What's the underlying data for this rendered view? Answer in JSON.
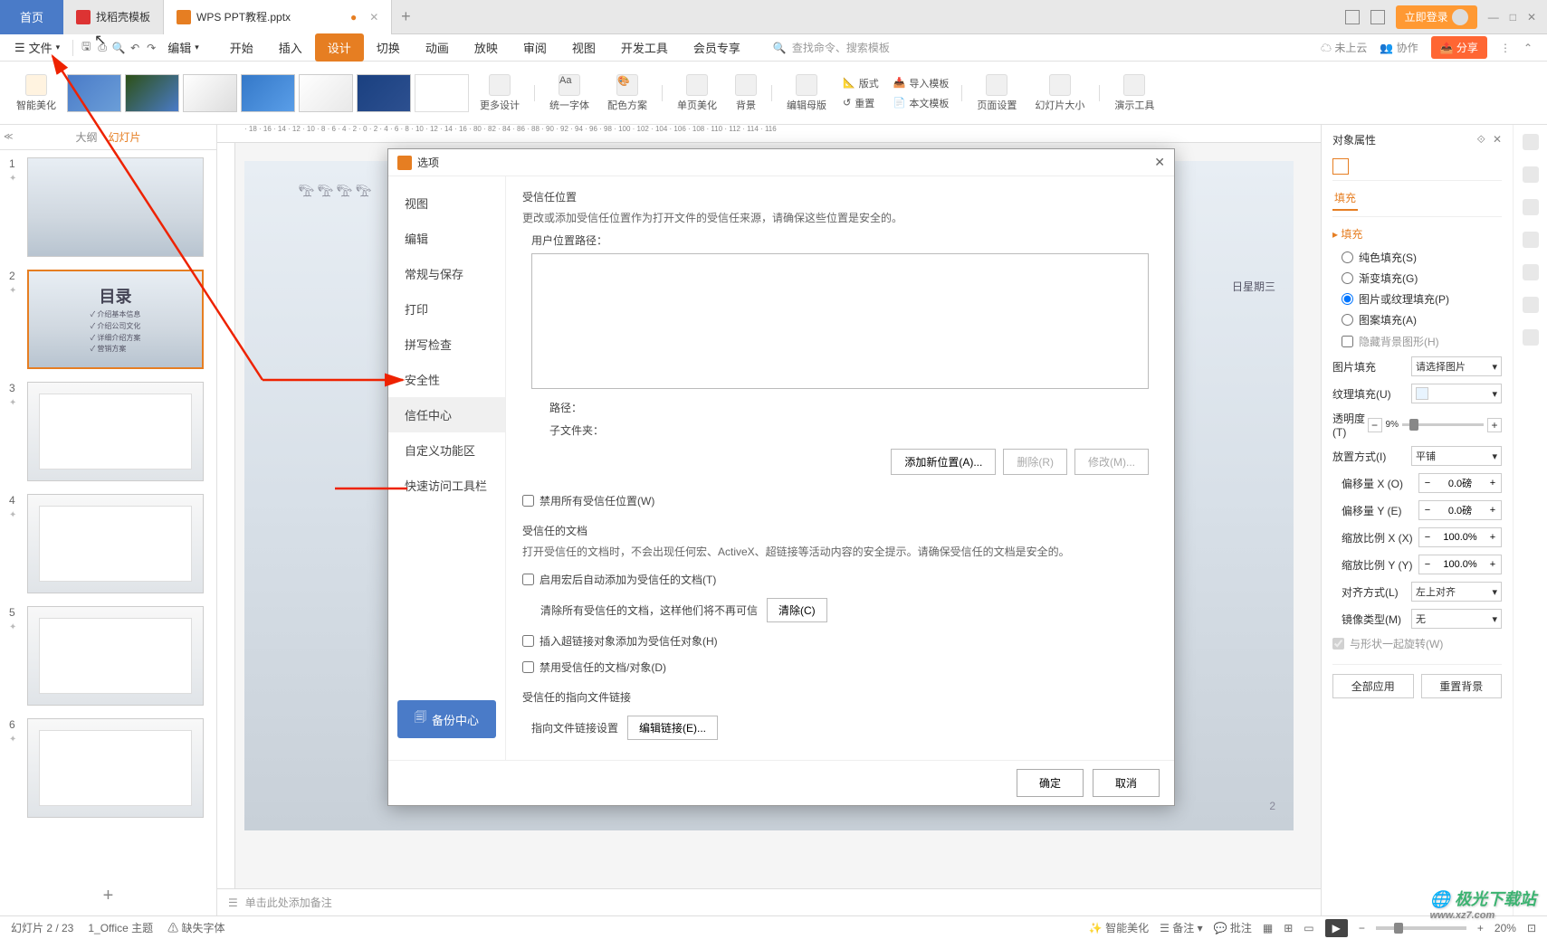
{
  "tabs": {
    "home": "首页",
    "template": "找稻壳模板",
    "doc": "WPS PPT教程.pptx"
  },
  "login": "立即登录",
  "menubar": {
    "file": "文件",
    "edit_dropdown": "编辑",
    "tabs": [
      "开始",
      "插入",
      "设计",
      "切换",
      "动画",
      "放映",
      "审阅",
      "视图",
      "开发工具",
      "会员专享"
    ],
    "active_tab_index": 2,
    "search_placeholder": "查找命令、搜索模板",
    "cloud": "未上云",
    "collab": "协作",
    "share": "分享"
  },
  "ribbon": {
    "smart_beautify": "智能美化",
    "more_design": "更多设计",
    "unify_font": "统一字体",
    "color_scheme": "配色方案",
    "single_page": "单页美化",
    "background": "背景",
    "edit_master": "编辑母版",
    "layout": "版式",
    "reset": "重置",
    "import_template": "导入模板",
    "this_template": "本文模板",
    "page_setup": "页面设置",
    "slide_size": "幻灯片大小",
    "presenter_tools": "演示工具"
  },
  "slide_panel": {
    "outline": "大纲",
    "slides": "幻灯片",
    "catalog_title": "目录",
    "catalog_items": [
      "介绍基本信息",
      "介绍公司文化",
      "详细介绍方案",
      "营销方案"
    ]
  },
  "canvas": {
    "date_text": "日星期三"
  },
  "notes_placeholder": "单击此处添加备注",
  "right_panel": {
    "title": "对象属性",
    "tab_fill": "填充",
    "section_fill": "填充",
    "radio_solid": "纯色填充(S)",
    "radio_gradient": "渐变填充(G)",
    "radio_picture": "图片或纹理填充(P)",
    "radio_pattern": "图案填充(A)",
    "check_hide_bg": "隐藏背景图形(H)",
    "picture_fill": "图片填充",
    "picture_fill_val": "请选择图片",
    "texture_fill": "纹理填充(U)",
    "transparency": "透明度(T)",
    "transparency_val": "9%",
    "place_mode": "放置方式(I)",
    "place_mode_val": "平铺",
    "offset_x": "偏移量 X (O)",
    "offset_x_val": "0.0磅",
    "offset_y": "偏移量 Y (E)",
    "offset_y_val": "0.0磅",
    "scale_x": "缩放比例 X (X)",
    "scale_x_val": "100.0%",
    "scale_y": "缩放比例 Y (Y)",
    "scale_y_val": "100.0%",
    "align": "对齐方式(L)",
    "align_val": "左上对齐",
    "mirror": "镜像类型(M)",
    "mirror_val": "无",
    "rotate_with_shape": "与形状一起旋转(W)",
    "apply_all": "全部应用",
    "reset_bg": "重置背景"
  },
  "dialog": {
    "title": "选项",
    "sidebar": [
      "视图",
      "编辑",
      "常规与保存",
      "打印",
      "拼写检查",
      "安全性",
      "信任中心",
      "自定义功能区",
      "快速访问工具栏"
    ],
    "active_index": 6,
    "backup": "备份中心",
    "section1_title": "受信任位置",
    "section1_desc": "更改或添加受信任位置作为打开文件的受信任来源，请确保这些位置是安全的。",
    "user_path_label": "用户位置路径：",
    "path_label": "路径：",
    "subfolder_label": "子文件夹：",
    "btn_add": "添加新位置(A)...",
    "btn_delete": "删除(R)",
    "btn_modify": "修改(M)...",
    "check_disable_trusted": "禁用所有受信任位置(W)",
    "section2_title": "受信任的文档",
    "section2_desc": "打开受信任的文档时，不会出现任何宏、ActiveX、超链接等活动内容的安全提示。请确保受信任的文档是安全的。",
    "check_auto_add": "启用宏后自动添加为受信任的文档(T)",
    "clear_trusted_desc": "清除所有受信任的文档，这样他们将不再可信",
    "btn_clear": "清除(C)",
    "check_hyperlink": "插入超链接对象添加为受信任对象(H)",
    "check_disable_doc": "禁用受信任的文档/对象(D)",
    "section3_title": "受信任的指向文件链接",
    "link_settings_label": "指向文件链接设置",
    "btn_edit_link": "编辑链接(E)...",
    "btn_ok": "确定",
    "btn_cancel": "取消"
  },
  "status": {
    "slide_info": "幻灯片 2 / 23",
    "theme": "1_Office 主题",
    "missing_font": "缺失字体",
    "smart_beautify": "智能美化",
    "notes": "备注",
    "comments": "批注",
    "zoom": "20%"
  },
  "watermark": {
    "main": "极光下载站",
    "sub": "www.xz7.com"
  }
}
